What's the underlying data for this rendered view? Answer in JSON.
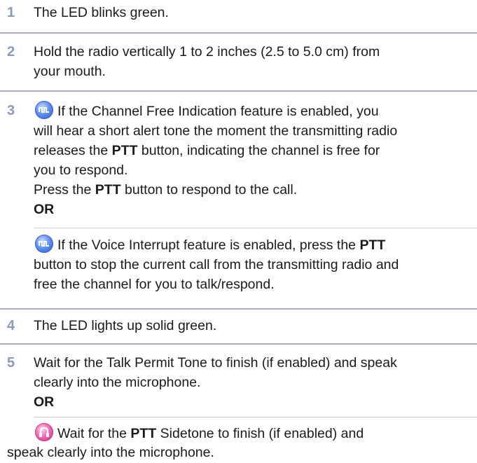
{
  "steps": [
    {
      "number": "1",
      "text": "The LED blinks green."
    },
    {
      "number": "2",
      "line1": "Hold the radio vertically 1 to 2 inches (2.5 to 5.0 cm) from",
      "line2": "your mouth."
    },
    {
      "number": "3",
      "block1": {
        "icon": "channel-free-feature-icon",
        "l1": "If the Channel Free Indication feature is enabled, you",
        "l2": "will hear a short alert tone the moment the transmitting radio",
        "l3_pre": "releases the ",
        "l3_bold": "PTT",
        "l3_post": " button, indicating the channel is free for",
        "l4": "you to respond.",
        "l5_pre": "Press the ",
        "l5_bold": "PTT",
        "l5_post": " button to respond to the call.",
        "or": "OR"
      },
      "block2": {
        "icon": "voice-interrupt-feature-icon",
        "l1_pre": "If the Voice Interrupt feature is enabled, press the ",
        "l1_bold": "PTT",
        "l2": "button to stop the current call from the transmitting radio and",
        "l3": "free the channel for you to talk/respond."
      }
    },
    {
      "number": "4",
      "text": "The LED lights up solid green."
    },
    {
      "number": "5",
      "block1": {
        "l1": "Wait for the Talk Permit Tone to finish (if enabled) and speak",
        "l2": "clearly into the microphone.",
        "or": "OR"
      },
      "block2": {
        "icon": "ptt-sidetone-feature-icon",
        "l1_pre": "Wait for the ",
        "l1_bold": "PTT",
        "l1_post": " Sidetone to finish (if enabled) and",
        "l2": "speak clearly into the microphone."
      }
    }
  ]
}
